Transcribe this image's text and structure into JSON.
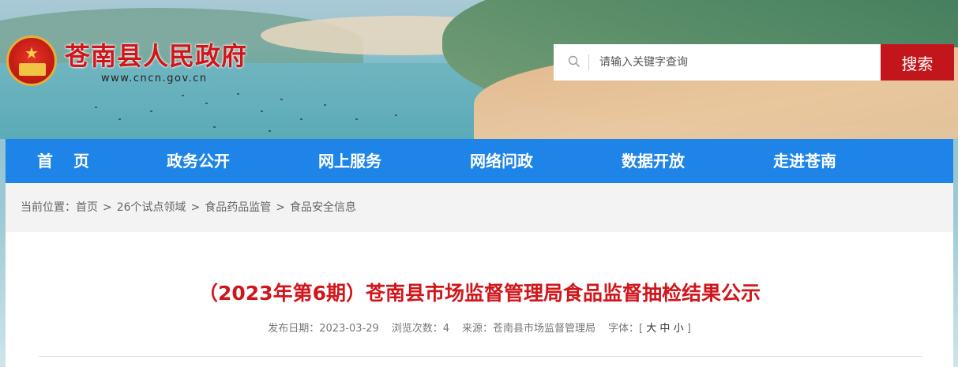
{
  "header": {
    "site_title": "苍南县人民政府",
    "site_url": "www.cncn.gov.cn"
  },
  "search": {
    "placeholder": "请输入关键字查询",
    "button_label": "搜索"
  },
  "nav": {
    "items": [
      {
        "label": "首页"
      },
      {
        "label": "政务公开"
      },
      {
        "label": "网上服务"
      },
      {
        "label": "网络问政"
      },
      {
        "label": "数据开放"
      },
      {
        "label": "走进苍南"
      }
    ]
  },
  "breadcrumb": {
    "prefix": "当前位置：",
    "items": [
      "首页",
      "26个试点领域",
      "食品药品监管",
      "食品安全信息"
    ],
    "separator": ">"
  },
  "article": {
    "title": "（2023年第6期）苍南县市场监督管理局食品监督抽检结果公示",
    "publish_date": "发布日期：2023-03-29",
    "views": "浏览次数：4",
    "source": "来源：苍南县市场监督管理局",
    "font_label": "字体：[",
    "font_large": "大",
    "font_medium": "中",
    "font_small": "小",
    "font_close": "]"
  },
  "colors": {
    "brand_red": "#c3161c",
    "nav_blue": "#1e84e8",
    "title_red": "#d0161b"
  }
}
